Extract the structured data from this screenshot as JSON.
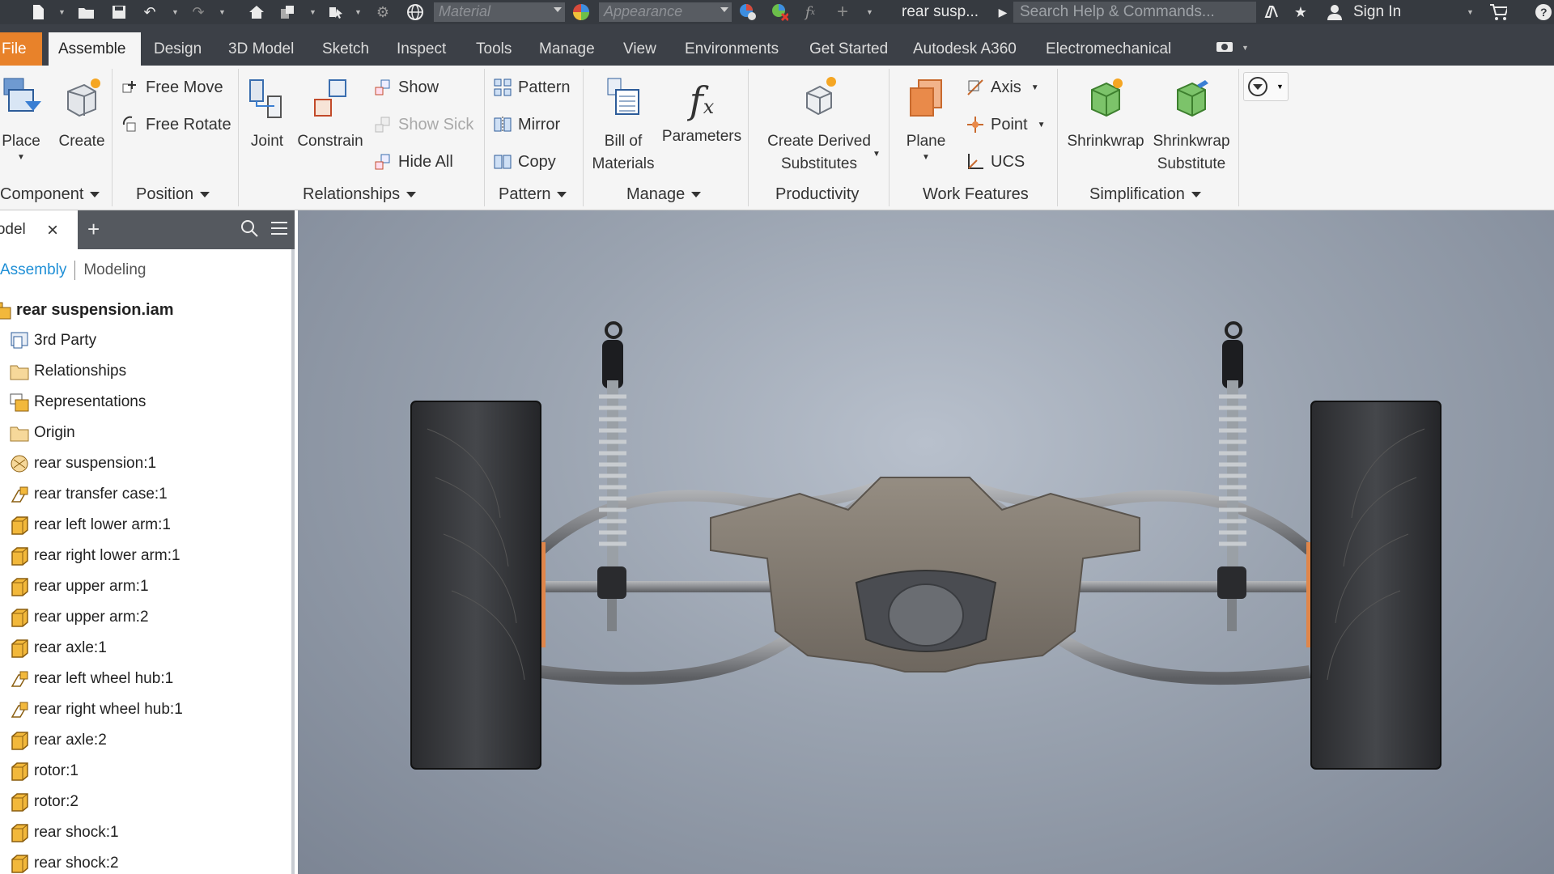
{
  "quick_access": {
    "material_placeholder": "Material",
    "appearance_placeholder": "Appearance",
    "document_name": "rear susp...",
    "search_placeholder": "Search Help & Commands...",
    "sign_in": "Sign In"
  },
  "tabs": [
    {
      "label": "File"
    },
    {
      "label": "Assemble"
    },
    {
      "label": "Design"
    },
    {
      "label": "3D Model"
    },
    {
      "label": "Sketch"
    },
    {
      "label": "Inspect"
    },
    {
      "label": "Tools"
    },
    {
      "label": "Manage"
    },
    {
      "label": "View"
    },
    {
      "label": "Environments"
    },
    {
      "label": "Get Started"
    },
    {
      "label": "Autodesk A360"
    },
    {
      "label": "Electromechanical"
    }
  ],
  "ribbon": {
    "component": {
      "title": "Component",
      "place": "Place",
      "create": "Create"
    },
    "position": {
      "title": "Position",
      "free_move": "Free Move",
      "free_rotate": "Free Rotate"
    },
    "relationships": {
      "title": "Relationships",
      "joint": "Joint",
      "constrain": "Constrain",
      "show": "Show",
      "show_sick": "Show Sick",
      "hide_all": "Hide All"
    },
    "pattern": {
      "title": "Pattern",
      "pattern": "Pattern",
      "mirror": "Mirror",
      "copy": "Copy"
    },
    "manage": {
      "title": "Manage",
      "bom_line1": "Bill of",
      "bom_line2": "Materials",
      "parameters": "Parameters"
    },
    "productivity": {
      "title": "Productivity",
      "cds_line1": "Create Derived",
      "cds_line2": "Substitutes"
    },
    "work_features": {
      "title": "Work Features",
      "plane": "Plane",
      "axis": "Axis",
      "point": "Point",
      "ucs": "UCS"
    },
    "simplification": {
      "title": "Simplification",
      "shrinkwrap": "Shrinkwrap",
      "sws_line1": "Shrinkwrap",
      "sws_line2": "Substitute"
    }
  },
  "browser": {
    "tab_label": "Model",
    "view_assembly": "Assembly",
    "view_modeling": "Modeling",
    "tree": [
      {
        "label": "rear suspension.iam",
        "icon": "assembly-root-icon"
      },
      {
        "label": "3rd Party",
        "icon": "third-party-icon"
      },
      {
        "label": "Relationships",
        "icon": "folder-icon"
      },
      {
        "label": "Representations",
        "icon": "representations-icon"
      },
      {
        "label": "Origin",
        "icon": "folder-icon"
      },
      {
        "label": "rear suspension:1",
        "icon": "weldment-icon"
      },
      {
        "label": "rear transfer case:1",
        "icon": "subassembly-icon"
      },
      {
        "label": "rear left lower arm:1",
        "icon": "part-icon"
      },
      {
        "label": "rear right lower arm:1",
        "icon": "part-icon"
      },
      {
        "label": "rear upper arm:1",
        "icon": "part-icon"
      },
      {
        "label": "rear upper arm:2",
        "icon": "part-icon"
      },
      {
        "label": "rear axle:1",
        "icon": "part-icon"
      },
      {
        "label": "rear left wheel hub:1",
        "icon": "subassembly-icon"
      },
      {
        "label": "rear right wheel hub:1",
        "icon": "subassembly-icon"
      },
      {
        "label": "rear axle:2",
        "icon": "part-icon"
      },
      {
        "label": "rotor:1",
        "icon": "part-icon"
      },
      {
        "label": "rotor:2",
        "icon": "part-icon"
      },
      {
        "label": "rear shock:1",
        "icon": "part-icon"
      },
      {
        "label": "rear shock:2",
        "icon": "part-icon"
      }
    ]
  },
  "colors": {
    "accent_file_tab": "#e8822a",
    "assembly_link": "#1f8fd6",
    "part_icon": "#f2b83b"
  }
}
